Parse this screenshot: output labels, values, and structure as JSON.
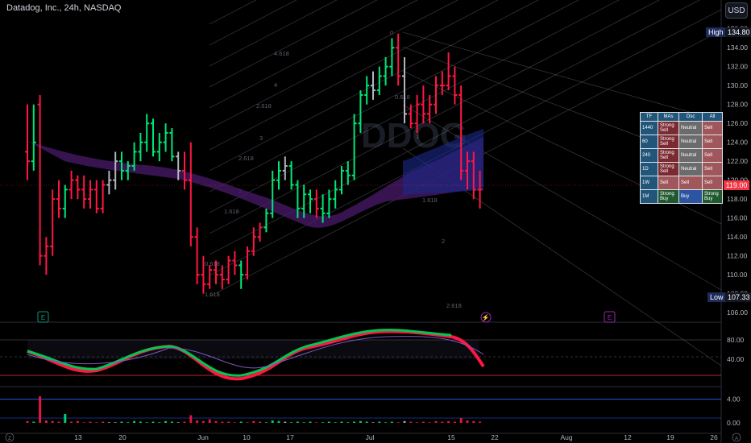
{
  "header": {
    "title": "Datadog, Inc., 24h, NASDAQ",
    "currency": "USD"
  },
  "watermark": "DDOG",
  "price_axis": {
    "ticks": [
      "136.00",
      "134.00",
      "132.00",
      "130.00",
      "128.00",
      "126.00",
      "124.00",
      "122.00",
      "120.00",
      "118.00",
      "116.00",
      "114.00",
      "112.00",
      "110.00",
      "108.00",
      "106.00"
    ],
    "high_label": "High",
    "high_value": "134.80",
    "low_label": "Low",
    "low_value": "107.33",
    "current_value": "119.00"
  },
  "oscillator_axis": {
    "ticks": [
      "80.00",
      "40.00"
    ]
  },
  "volume_axis": {
    "ticks": [
      "4.00",
      "0.00"
    ]
  },
  "time_axis": {
    "left_icon": "Z",
    "right_icon": "A",
    "labels": [
      "13",
      "20",
      "Jun",
      "10",
      "17",
      "Jul",
      "15",
      "22",
      "Aug",
      "12",
      "19",
      "26"
    ]
  },
  "fib_labels": [
    "4.618",
    "4",
    "2.618",
    "3",
    "1",
    "2.618",
    "2",
    "1.618",
    "1.618",
    "0.618",
    "0",
    "0.618",
    "1.618",
    "2",
    "2.618"
  ],
  "events": [
    {
      "icon": "earnings-icon",
      "label": "E",
      "color": "#089981"
    },
    {
      "icon": "split-icon",
      "label": "⚡",
      "color": "#9c27b0"
    },
    {
      "icon": "earnings-icon",
      "label": "E",
      "color": "#9c27b0"
    }
  ],
  "signal_table": {
    "headers": [
      "TF",
      "MAs",
      "Osc",
      "All"
    ],
    "rows": [
      {
        "tf": "1440",
        "mas": "Strong Sell",
        "osc": "Neutral",
        "all": "Sell"
      },
      {
        "tf": "60",
        "mas": "Strong Sell",
        "osc": "Neutral",
        "all": "Sell"
      },
      {
        "tf": "240",
        "mas": "Strong Sell",
        "osc": "Neutral",
        "all": "Sell"
      },
      {
        "tf": "1D",
        "mas": "Strong Sell",
        "osc": "Neutral",
        "all": "Sell"
      },
      {
        "tf": "1W",
        "mas": "Sell",
        "osc": "Sell",
        "all": "Sell"
      },
      {
        "tf": "1M",
        "mas": "Strong Buy",
        "osc": "Buy",
        "all": "Strong Buy"
      }
    ]
  },
  "colors": {
    "up": "#00e676",
    "down": "#ff1744",
    "neutral": "#b2b5be",
    "background": "#000000",
    "grid": "#1e222d"
  },
  "chart_data": {
    "type": "ohlc",
    "ylim": [
      105.5,
      137
    ],
    "bars": [
      {
        "o": 123,
        "h": 128,
        "l": 120,
        "c": 122,
        "color": "down"
      },
      {
        "o": 122,
        "h": 128,
        "l": 121,
        "c": 124,
        "color": "up"
      },
      {
        "o": 128,
        "h": 129,
        "l": 111,
        "c": 112,
        "color": "down"
      },
      {
        "o": 112,
        "h": 114,
        "l": 110,
        "c": 113,
        "color": "down"
      },
      {
        "o": 113,
        "h": 119,
        "l": 112,
        "c": 118,
        "color": "down"
      },
      {
        "o": 118,
        "h": 120,
        "l": 116,
        "c": 117,
        "color": "down"
      },
      {
        "o": 117,
        "h": 119.5,
        "l": 116,
        "c": 119,
        "color": "up"
      },
      {
        "o": 119,
        "h": 121,
        "l": 118,
        "c": 120,
        "color": "down"
      },
      {
        "o": 120,
        "h": 120.5,
        "l": 118,
        "c": 119,
        "color": "down"
      },
      {
        "o": 119,
        "h": 120.5,
        "l": 117,
        "c": 118,
        "color": "down"
      },
      {
        "o": 118,
        "h": 120,
        "l": 117,
        "c": 119,
        "color": "down"
      },
      {
        "o": 119,
        "h": 120,
        "l": 116.5,
        "c": 117,
        "color": "down"
      },
      {
        "o": 117,
        "h": 120,
        "l": 116.5,
        "c": 119.5,
        "color": "down"
      },
      {
        "o": 119.5,
        "h": 121,
        "l": 118.5,
        "c": 120,
        "color": "neutral"
      },
      {
        "o": 120,
        "h": 123,
        "l": 119,
        "c": 122,
        "color": "neutral"
      },
      {
        "o": 122,
        "h": 123,
        "l": 120,
        "c": 121,
        "color": "up"
      },
      {
        "o": 121,
        "h": 122,
        "l": 120,
        "c": 121.5,
        "color": "up"
      },
      {
        "o": 121.5,
        "h": 124,
        "l": 121,
        "c": 123,
        "color": "up"
      },
      {
        "o": 123,
        "h": 125,
        "l": 122,
        "c": 124,
        "color": "up"
      },
      {
        "o": 124,
        "h": 127,
        "l": 123,
        "c": 126,
        "color": "up"
      },
      {
        "o": 126,
        "h": 126.5,
        "l": 122.5,
        "c": 123,
        "color": "up"
      },
      {
        "o": 123,
        "h": 125,
        "l": 122,
        "c": 124,
        "color": "up"
      },
      {
        "o": 124,
        "h": 126,
        "l": 123,
        "c": 125,
        "color": "up"
      },
      {
        "o": 125,
        "h": 125.5,
        "l": 122,
        "c": 122.5,
        "color": "up"
      },
      {
        "o": 122.5,
        "h": 123,
        "l": 120,
        "c": 121,
        "color": "neutral"
      },
      {
        "o": 121,
        "h": 123,
        "l": 119,
        "c": 120,
        "color": "down"
      },
      {
        "o": 120,
        "h": 124,
        "l": 113,
        "c": 114,
        "color": "down"
      },
      {
        "o": 114,
        "h": 115,
        "l": 109,
        "c": 110,
        "color": "down"
      },
      {
        "o": 110,
        "h": 112,
        "l": 108,
        "c": 109,
        "color": "down"
      },
      {
        "o": 109,
        "h": 111,
        "l": 108.5,
        "c": 110.5,
        "color": "down"
      },
      {
        "o": 110.5,
        "h": 111.5,
        "l": 109,
        "c": 110,
        "color": "down"
      },
      {
        "o": 110,
        "h": 111,
        "l": 108.5,
        "c": 109.5,
        "color": "down"
      },
      {
        "o": 109.5,
        "h": 112,
        "l": 109,
        "c": 111.5,
        "color": "down"
      },
      {
        "o": 111.5,
        "h": 112.5,
        "l": 110,
        "c": 111,
        "color": "down"
      },
      {
        "o": 111,
        "h": 111.5,
        "l": 108.5,
        "c": 110,
        "color": "up"
      },
      {
        "o": 110,
        "h": 113,
        "l": 109.5,
        "c": 112.5,
        "color": "down"
      },
      {
        "o": 112.5,
        "h": 115,
        "l": 112,
        "c": 114,
        "color": "down"
      },
      {
        "o": 114,
        "h": 115.5,
        "l": 113.5,
        "c": 115,
        "color": "down"
      },
      {
        "o": 115,
        "h": 117,
        "l": 114.5,
        "c": 116.5,
        "color": "up"
      },
      {
        "o": 116.5,
        "h": 121,
        "l": 116,
        "c": 120,
        "color": "up"
      },
      {
        "o": 120,
        "h": 122,
        "l": 119,
        "c": 121,
        "color": "up"
      },
      {
        "o": 121,
        "h": 122.5,
        "l": 120,
        "c": 121.5,
        "color": "neutral"
      },
      {
        "o": 121.5,
        "h": 122,
        "l": 119,
        "c": 119.5,
        "color": "up"
      },
      {
        "o": 119.5,
        "h": 120,
        "l": 116,
        "c": 117,
        "color": "up"
      },
      {
        "o": 117,
        "h": 119.5,
        "l": 116,
        "c": 118.5,
        "color": "up"
      },
      {
        "o": 118.5,
        "h": 119,
        "l": 116.5,
        "c": 118,
        "color": "up"
      },
      {
        "o": 118,
        "h": 119,
        "l": 116,
        "c": 117,
        "color": "down"
      },
      {
        "o": 117,
        "h": 118.5,
        "l": 115.5,
        "c": 116.5,
        "color": "up"
      },
      {
        "o": 116.5,
        "h": 119,
        "l": 116,
        "c": 118,
        "color": "up"
      },
      {
        "o": 118,
        "h": 120,
        "l": 117,
        "c": 119,
        "color": "up"
      },
      {
        "o": 119,
        "h": 121.5,
        "l": 118.5,
        "c": 121,
        "color": "up"
      },
      {
        "o": 121,
        "h": 122,
        "l": 119.5,
        "c": 120.5,
        "color": "up"
      },
      {
        "o": 120.5,
        "h": 127,
        "l": 120,
        "c": 126,
        "color": "up"
      },
      {
        "o": 126,
        "h": 129.5,
        "l": 125,
        "c": 129,
        "color": "up"
      },
      {
        "o": 129,
        "h": 131,
        "l": 128,
        "c": 130,
        "color": "up"
      },
      {
        "o": 130,
        "h": 131.5,
        "l": 128.5,
        "c": 129.5,
        "color": "neutral"
      },
      {
        "o": 129.5,
        "h": 132,
        "l": 129,
        "c": 131,
        "color": "up"
      },
      {
        "o": 131,
        "h": 133,
        "l": 130,
        "c": 132,
        "color": "up"
      },
      {
        "o": 132,
        "h": 135,
        "l": 131,
        "c": 134,
        "color": "up"
      },
      {
        "o": 134,
        "h": 135.5,
        "l": 130,
        "c": 131,
        "color": "down"
      },
      {
        "o": 131,
        "h": 133,
        "l": 126,
        "c": 127,
        "color": "neutral"
      },
      {
        "o": 127,
        "h": 128,
        "l": 125.5,
        "c": 126,
        "color": "down"
      },
      {
        "o": 126,
        "h": 129,
        "l": 125,
        "c": 128,
        "color": "down"
      },
      {
        "o": 128,
        "h": 130,
        "l": 126,
        "c": 127,
        "color": "down"
      },
      {
        "o": 127,
        "h": 129,
        "l": 126,
        "c": 128,
        "color": "down"
      },
      {
        "o": 128,
        "h": 131,
        "l": 127,
        "c": 130,
        "color": "down"
      },
      {
        "o": 130,
        "h": 131.5,
        "l": 129,
        "c": 130,
        "color": "down"
      },
      {
        "o": 130,
        "h": 133.5,
        "l": 129.5,
        "c": 131,
        "color": "down"
      },
      {
        "o": 131,
        "h": 132,
        "l": 128,
        "c": 129,
        "color": "down"
      },
      {
        "o": 129,
        "h": 130,
        "l": 120,
        "c": 121,
        "color": "down"
      },
      {
        "o": 121,
        "h": 123,
        "l": 119,
        "c": 122,
        "color": "down"
      },
      {
        "o": 122,
        "h": 123,
        "l": 118,
        "c": 119,
        "color": "down"
      },
      {
        "o": 119,
        "h": 121,
        "l": 117,
        "c": 119,
        "color": "down"
      }
    ],
    "osc_levels": [
      80,
      40
    ],
    "vol_levels": [
      4,
      0
    ]
  }
}
